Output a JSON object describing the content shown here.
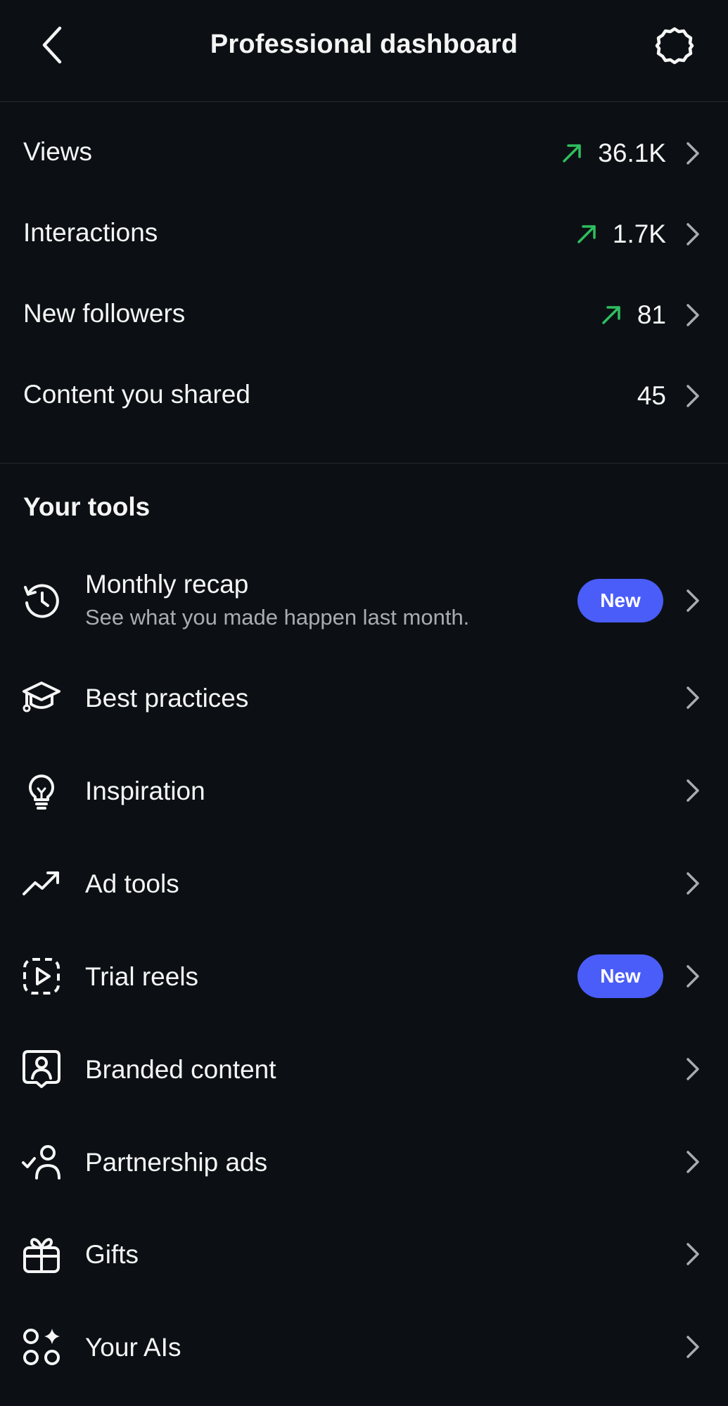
{
  "header": {
    "title": "Professional dashboard",
    "back_icon": "chevron-left-icon",
    "settings_icon": "gear-icon"
  },
  "colors": {
    "background": "#0c1014",
    "text": "#f5f5f5",
    "subtext": "#a8adb3",
    "trend_up": "#2ebf5f",
    "badge": "#4a5df9",
    "divider": "#262a2e"
  },
  "stats": [
    {
      "label": "Views",
      "value": "36.1K",
      "trend": "up"
    },
    {
      "label": "Interactions",
      "value": "1.7K",
      "trend": "up"
    },
    {
      "label": "New followers",
      "value": "81",
      "trend": "up"
    },
    {
      "label": "Content you shared",
      "value": "45",
      "trend": "none"
    }
  ],
  "tools_section": {
    "title": "Your tools",
    "items": [
      {
        "label": "Monthly recap",
        "subtitle": "See what you made happen last month.",
        "badge": "New",
        "icon": "history-clock-icon"
      },
      {
        "label": "Best practices",
        "icon": "graduation-cap-icon"
      },
      {
        "label": "Inspiration",
        "icon": "lightbulb-icon"
      },
      {
        "label": "Ad tools",
        "icon": "trending-up-icon"
      },
      {
        "label": "Trial reels",
        "badge": "New",
        "icon": "reels-play-icon"
      },
      {
        "label": "Branded content",
        "icon": "branded-content-icon"
      },
      {
        "label": "Partnership ads",
        "icon": "person-check-icon"
      },
      {
        "label": "Gifts",
        "icon": "gift-icon"
      },
      {
        "label": "Your AIs",
        "icon": "ai-sparkle-icon"
      }
    ]
  }
}
